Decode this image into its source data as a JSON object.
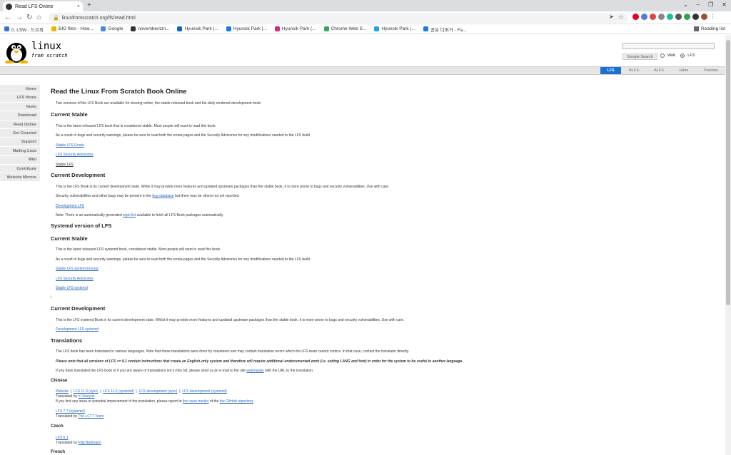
{
  "browser": {
    "tab_title": "Read LFS Online",
    "tab_close": "×",
    "new_tab": "+",
    "url": "linuxfromscratch.org/lfs/read.html",
    "window_controls": [
      "⌄",
      "–",
      "❐",
      "✕"
    ]
  },
  "bookmarks": [
    {
      "label": "0. LSW - 드르륵",
      "color": "#3b6fd8"
    },
    {
      "label": "BIG files - How...",
      "color": "#f0b400"
    },
    {
      "label": "Google",
      "color": "#4285f4"
    },
    {
      "label": "novemberizin...",
      "color": "#333333"
    },
    {
      "label": "Hyunsik Park |...",
      "color": "#0a66c2"
    },
    {
      "label": "Hyunsik Park |...",
      "color": "#1877f2"
    },
    {
      "label": "Hyunsik Park (...",
      "color": "#d62976"
    },
    {
      "label": "Chrome Web S...",
      "color": "#34a853"
    },
    {
      "label": "Hyunsik Park (...",
      "color": "#1da1f2"
    },
    {
      "label": "공유 디버거 - Fa...",
      "color": "#1877f2"
    }
  ],
  "reading_list": "Reading list",
  "site": {
    "logo_line1": "linux",
    "logo_line2": "from scratch",
    "search_button": "Google Search",
    "radio_web": "Web",
    "radio_lfs": "LFS"
  },
  "topnav": [
    {
      "label": "LFS",
      "active": true
    },
    {
      "label": "BLFS",
      "active": false
    },
    {
      "label": "ALFS",
      "active": false
    },
    {
      "label": "Hints",
      "active": false
    },
    {
      "label": "Patches",
      "active": false
    }
  ],
  "sidebar": [
    "Home",
    "LFS Home",
    "News",
    "Download",
    "Read Online",
    "Get Counted",
    "Support",
    "Mailing Lists",
    "Wiki",
    "Contribute",
    "Website Mirrors"
  ],
  "content": {
    "title": "Read the Linux From Scratch Book Online",
    "intro": "Two versions of the LFS Book are available for viewing online, the stable released book and the daily rendered development book:",
    "stable_heading": "Current Stable",
    "stable_p1": "This is the latest released LFS book that is considered stable. Most people will want to read this book.",
    "stable_p2": "As a result of bugs and security warnings, please be sure to read both the errata pages and the Security Advisories for any modifications needed to the LFS build.",
    "stable_link1": "Stable LFS Errata",
    "stable_link2": "LFS Security Advisories",
    "stable_link3": "Stable LFS",
    "dev_heading": "Current Development",
    "dev_p1": "This is the LFS Book in its current development state. While it may provide more features and updated upstream packages than the stable book, it is more prone to bugs and security vulnerabilities. Use with care.",
    "dev_p2_pre": "Security vulnerabilities and other bugs may be present in the ",
    "dev_p2_link": "bug database",
    "dev_p2_post": " but there may be others not yet reported.",
    "dev_link": "Development LFS",
    "dev_note_pre": "Note: There is an automatically generated ",
    "dev_note_link": "wget list",
    "dev_note_post": " available to fetch all LFS Book packages automatically.",
    "systemd_heading": "Systemd version of LFS",
    "sd_stable_heading": "Current Stable",
    "sd_stable_p1": "This is the latest released LFS systemd book, considered stable. Most people will want to read this book.",
    "sd_stable_p2": "As a result of bugs and security warnings, please be sure to read both the errata pages and the Security Advisories for any modifications needed to the LFS build.",
    "sd_link1": "Stable LFS systemd Errata",
    "sd_link2": "LFS Security Advisories",
    "sd_link3": "Stable LFS systemd",
    "sd_stray": "i",
    "sd_dev_heading": "Current Development",
    "sd_dev_p1": "This is the LFS systemd Book in its current development state. Whilst it may provide more features and updated upstream packages than the stable book, it is more prone to bugs and security vulnerabilities. Use with care.",
    "sd_dev_link": "Development LFS systemd",
    "trans_heading": "Translations",
    "trans_p1": "The LFS book has been translated in various languages. Note that these translations were done by volunteers and may contain translation errors which the LFS team cannot control. In that case, contact the translator directly.",
    "trans_p2": "Please note that all versions of LFS <= 9.1 contain instructions that create an English-only system and therefore will require additional undocumented work (i.e. setting LANG and font) in order for the system to be useful in another language.",
    "trans_p3_pre": "If you have translated the LFS book or if you are aware of translations not in this list, please send us an e-mail to the site ",
    "trans_p3_link": "webmaster",
    "trans_p3_post": " with the URL to the translation.",
    "chinese_heading": "Chinese",
    "chinese_links": [
      "Website",
      "LFS 11.0 (sysv)",
      "LFS 11.0 (systemd)",
      "LFS development (sysv)",
      "LFS development (systemd)"
    ],
    "chinese_sep": "|",
    "chinese_translated_pre": "Translated by ",
    "chinese_translator": "Xi Ruoyao",
    "chinese_issue_pre": "If you find any issue or potential improvement of the translation, please report to ",
    "chinese_issue_link1": "the issue tracker",
    "chinese_issue_mid": " of the ",
    "chinese_issue_link2": "the GitHub repository",
    "chinese_issue_post": ".",
    "chinese_77": "LFS 7.7 (systemd)",
    "chinese_77_translated_pre": "Translated by ",
    "chinese_77_translator": "The LCTT Team",
    "czech_heading": "Czech",
    "czech_link": "LFS 6.1",
    "czech_translated_pre": "Translated by ",
    "czech_translator": "Filip Bartmann",
    "french_heading": "French"
  }
}
